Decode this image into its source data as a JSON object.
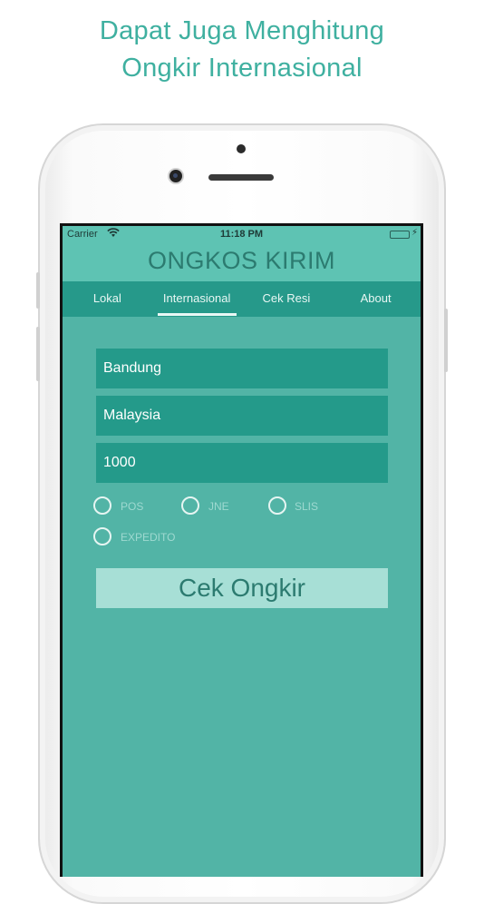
{
  "promo": {
    "line1": "Dapat Juga Menghitung",
    "line2": "Ongkir Internasional"
  },
  "statusbar": {
    "carrier": "Carrier",
    "time": "11:18 PM",
    "wifi_icon": "wifi-icon",
    "battery_icon": "battery-icon"
  },
  "app": {
    "title": "ONGKOS KIRIM",
    "tabs": [
      {
        "label": "Lokal",
        "active": false
      },
      {
        "label": "Internasional",
        "active": true
      },
      {
        "label": "Cek Resi",
        "active": false
      },
      {
        "label": "About",
        "active": false
      }
    ],
    "form": {
      "origin": "Bandung",
      "destination": "Malaysia",
      "weight": "1000"
    },
    "couriers": [
      {
        "label": "POS",
        "selected": false
      },
      {
        "label": "JNE",
        "selected": false
      },
      {
        "label": "SLIS",
        "selected": false
      },
      {
        "label": "EXPEDITO",
        "selected": false
      }
    ],
    "submit_label": "Cek Ongkir"
  },
  "colors": {
    "accent": "#3fb0a0",
    "screen_bg": "#52b4a6",
    "tab_bar": "#26998a",
    "field_bg": "#249a8a",
    "button_bg": "#a7dfd6"
  }
}
